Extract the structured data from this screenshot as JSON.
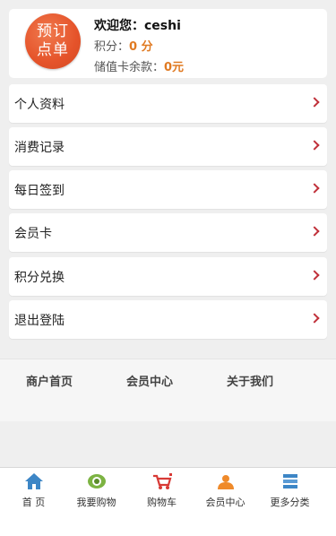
{
  "profile": {
    "logo_top": "预订",
    "logo_bottom": "点单",
    "welcome_label": "欢迎您：",
    "username": "ceshi",
    "points_label": "积分：",
    "points_value": "0 分",
    "balance_label": "储值卡余款：",
    "balance_value": "0元"
  },
  "menu": [
    {
      "label": "个人资料"
    },
    {
      "label": "消费记录"
    },
    {
      "label": "每日签到"
    },
    {
      "label": "会员卡"
    },
    {
      "label": "积分兑换"
    },
    {
      "label": "退出登陆"
    }
  ],
  "footer_links": [
    "商户首页",
    "会员中心",
    "关于我们"
  ],
  "tabbar": [
    {
      "label": "首 页",
      "icon": "home-icon",
      "color": "#3d86c6"
    },
    {
      "label": "我要购物",
      "icon": "eye-icon",
      "color": "#6fa83a"
    },
    {
      "label": "购物车",
      "icon": "cart-icon",
      "color": "#d83a36"
    },
    {
      "label": "会员中心",
      "icon": "member-icon",
      "color": "#ef8a2a"
    },
    {
      "label": "更多分类",
      "icon": "list-icon",
      "color": "#3d86c6"
    }
  ]
}
